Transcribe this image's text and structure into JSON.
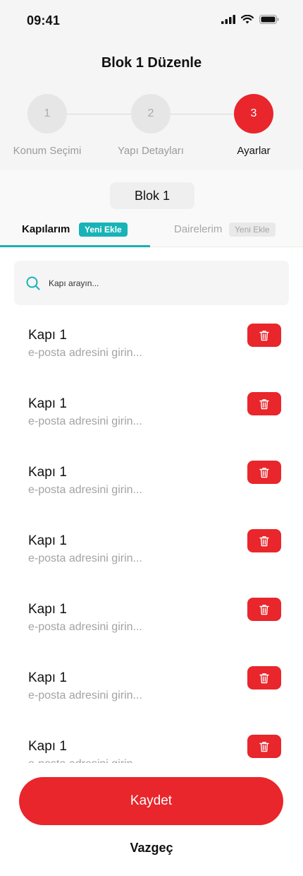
{
  "status_bar": {
    "time": "09:41"
  },
  "header": {
    "title": "Blok 1 Düzenle"
  },
  "stepper": {
    "steps": [
      {
        "number": "1",
        "label": "Konum Seçimi",
        "active": false
      },
      {
        "number": "2",
        "label": "Yapı Detayları",
        "active": false
      },
      {
        "number": "3",
        "label": "Ayarlar",
        "active": true
      }
    ]
  },
  "block": {
    "name": "Blok 1"
  },
  "tabs": [
    {
      "label": "Kapılarım",
      "badge": "Yeni Ekle",
      "selected": true
    },
    {
      "label": "Dairelerim",
      "badge": "Yeni Ekle",
      "selected": false
    }
  ],
  "search": {
    "placeholder": "Kapı arayın..."
  },
  "doors": [
    {
      "name": "Kapı 1",
      "email_placeholder": "e-posta adresini girin..."
    },
    {
      "name": "Kapı 1",
      "email_placeholder": "e-posta adresini girin..."
    },
    {
      "name": "Kapı 1",
      "email_placeholder": "e-posta adresini girin..."
    },
    {
      "name": "Kapı 1",
      "email_placeholder": "e-posta adresini girin..."
    },
    {
      "name": "Kapı 1",
      "email_placeholder": "e-posta adresini girin..."
    },
    {
      "name": "Kapı 1",
      "email_placeholder": "e-posta adresini girin..."
    },
    {
      "name": "Kapı 1",
      "email_placeholder": "e-posta adresini girin..."
    }
  ],
  "actions": {
    "save_label": "Kaydet",
    "cancel_label": "Vazgeç"
  },
  "colors": {
    "accent": "#e8262b",
    "teal": "#18b3b6"
  },
  "icons": {
    "search": "search-icon",
    "delete": "trash-icon",
    "signal": "signal-icon",
    "wifi": "wifi-icon",
    "battery": "battery-icon"
  }
}
